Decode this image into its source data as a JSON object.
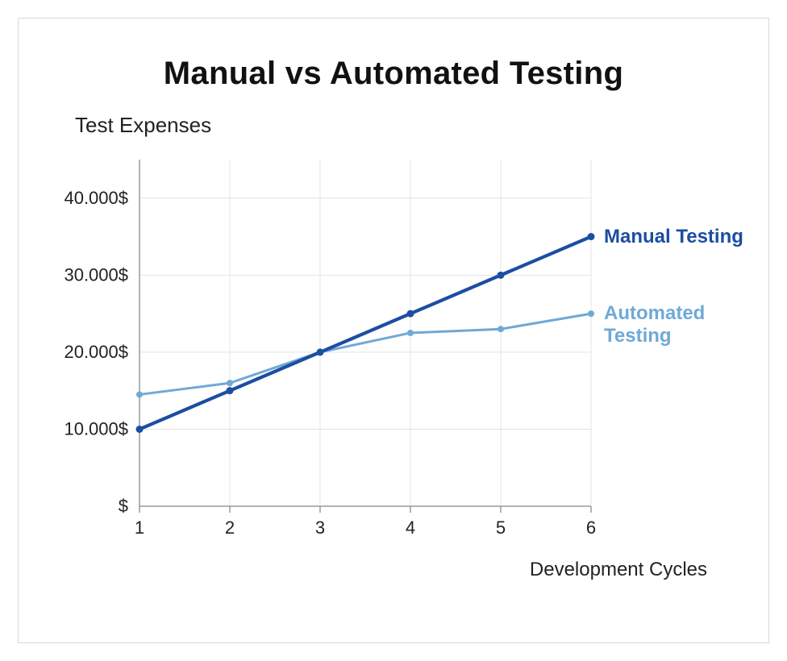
{
  "chart_data": {
    "type": "line",
    "title": "Manual vs Automated Testing",
    "y_axis_title": "Test Expenses",
    "x_axis_title": "Development Cycles",
    "x": [
      1,
      2,
      3,
      4,
      5,
      6
    ],
    "y_ticks": [
      {
        "value": 0,
        "label": "$"
      },
      {
        "value": 10000,
        "label": "10.000$"
      },
      {
        "value": 20000,
        "label": "20.000$"
      },
      {
        "value": 30000,
        "label": "30.000$"
      },
      {
        "value": 40000,
        "label": "40.000$"
      }
    ],
    "ylim": [
      0,
      45000
    ],
    "series": [
      {
        "name": "Manual Testing",
        "key": "manual",
        "color": "#1c4ea1",
        "values": [
          10000,
          15000,
          20000,
          25000,
          30000,
          35000
        ]
      },
      {
        "name": "Automated Testing",
        "key": "auto",
        "color": "#6fa9d6",
        "values": [
          14500,
          16000,
          20000,
          22500,
          23000,
          25000
        ]
      }
    ],
    "xlabel": "Development Cycles",
    "ylabel": "Test Expenses"
  }
}
